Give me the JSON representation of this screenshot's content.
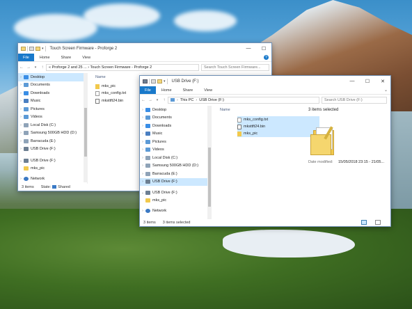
{
  "window_back": {
    "title": "Touch Screen Firmware - Proforge 2",
    "menu": {
      "file": "File",
      "home": "Home",
      "share": "Share",
      "view": "View"
    },
    "help_icon": "?",
    "address": "« Proforge 2 and 25 ... › Touch Screen Firmware - Proforge 2",
    "search_placeholder": "Search Touch Screen Firmware...",
    "nav_items": [
      {
        "label": "Desktop",
        "icon": "desktop-icon"
      },
      {
        "label": "Documents",
        "icon": "documents-icon"
      },
      {
        "label": "Downloads",
        "icon": "downloads-icon"
      },
      {
        "label": "Music",
        "icon": "music-icon"
      },
      {
        "label": "Pictures",
        "icon": "pictures-icon"
      },
      {
        "label": "Videos",
        "icon": "videos-icon"
      },
      {
        "label": "Local Disk (C:)",
        "icon": "drive-icon"
      },
      {
        "label": "Samsung 500GB HDD (D:)",
        "icon": "drive-icon"
      },
      {
        "label": "Barracuda (E:)",
        "icon": "drive-icon"
      },
      {
        "label": "USB Drive (F:)",
        "icon": "usb-drive-icon"
      },
      {
        "label": "USB Drive (F:)",
        "icon": "usb-drive-icon"
      },
      {
        "label": "mks_pic",
        "icon": "folder-icon"
      },
      {
        "label": "Network",
        "icon": "network-icon"
      }
    ],
    "column_name": "Name",
    "files": [
      {
        "name": "mks_pic",
        "type": "folder"
      },
      {
        "name": "mks_config.txt",
        "type": "txt"
      },
      {
        "name": "mksttft24.bin",
        "type": "bin"
      }
    ],
    "status": {
      "count": "3 items",
      "state_label": "State:",
      "state_value": "Shared"
    }
  },
  "window_front": {
    "title": "USB Drive (F:)",
    "menu": {
      "file": "File",
      "home": "Home",
      "share": "Share",
      "view": "View"
    },
    "address_parts": [
      "This PC",
      "USB Drive (F:)"
    ],
    "search_placeholder": "Search USB Drive (F:)",
    "nav_items": [
      {
        "label": "Desktop",
        "icon": "desktop-icon"
      },
      {
        "label": "Documents",
        "icon": "documents-icon"
      },
      {
        "label": "Downloads",
        "icon": "downloads-icon"
      },
      {
        "label": "Music",
        "icon": "music-icon"
      },
      {
        "label": "Pictures",
        "icon": "pictures-icon"
      },
      {
        "label": "Videos",
        "icon": "videos-icon"
      },
      {
        "label": "Local Disk (C:)",
        "icon": "drive-icon"
      },
      {
        "label": "Samsung 500GB HDD (D:)",
        "icon": "drive-icon"
      },
      {
        "label": "Barracuda (E:)",
        "icon": "drive-icon"
      },
      {
        "label": "USB Drive (F:)",
        "icon": "usb-drive-icon"
      },
      {
        "label": "USB Drive (F:)",
        "icon": "usb-drive-icon"
      },
      {
        "label": "mks_pic",
        "icon": "folder-icon"
      },
      {
        "label": "Network",
        "icon": "network-icon"
      }
    ],
    "column_name": "Name",
    "files": [
      {
        "name": "mks_config.txt",
        "type": "txt"
      },
      {
        "name": "mksttft24.bin",
        "type": "bin"
      },
      {
        "name": "mks_pic",
        "type": "folder"
      }
    ],
    "details": {
      "selected_count": "3 items selected",
      "date_label": "Date modified:",
      "date_value": "15/05/2018 23:15 - 21/05..."
    },
    "status": {
      "count": "3 items",
      "selected": "3 items selected"
    }
  },
  "colors": {
    "accent": "#1979ca",
    "selection": "#cce8ff"
  }
}
